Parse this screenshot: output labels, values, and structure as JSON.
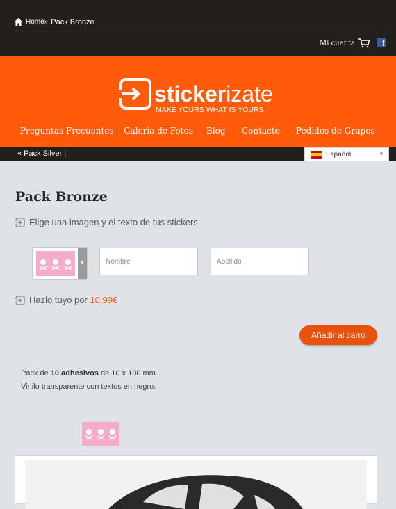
{
  "breadcrumb": {
    "home": "Home»",
    "current": "Pack Bronze"
  },
  "account": {
    "my_account": "Mi cuenta",
    "fb": "f"
  },
  "logo": {
    "brand_a": "sticker",
    "brand_b": "izate",
    "tagline": "MAKE YOURS WHAT IS YOURS"
  },
  "nav": {
    "items": [
      "Preguntas Frecuentes",
      "Galeria de Fotos",
      "Blog",
      "Contacto",
      "Pedidos de Grupos"
    ]
  },
  "subnav": {
    "prev": "« Pack Silver |"
  },
  "language": {
    "selected": "Español"
  },
  "product": {
    "title": "Pack Bronze",
    "step1": "Elige una imagen y el texto de tus stickers",
    "first_name_placeholder": "Nombre",
    "last_name_placeholder": "Apellido",
    "step2": "Hazlo tuyo por",
    "price": "10,99€",
    "add_to_cart": "Añadir al carro",
    "desc_a": "Pack de",
    "desc_bold": "10 adhesivos",
    "desc_b": "de 10 x 100 mm.",
    "desc_line2": "Vinilo transparente con textos en negro."
  },
  "colors": {
    "accent": "#ff5b0a",
    "dark": "#231f1d",
    "sticker_pink": "#f4acc8"
  }
}
